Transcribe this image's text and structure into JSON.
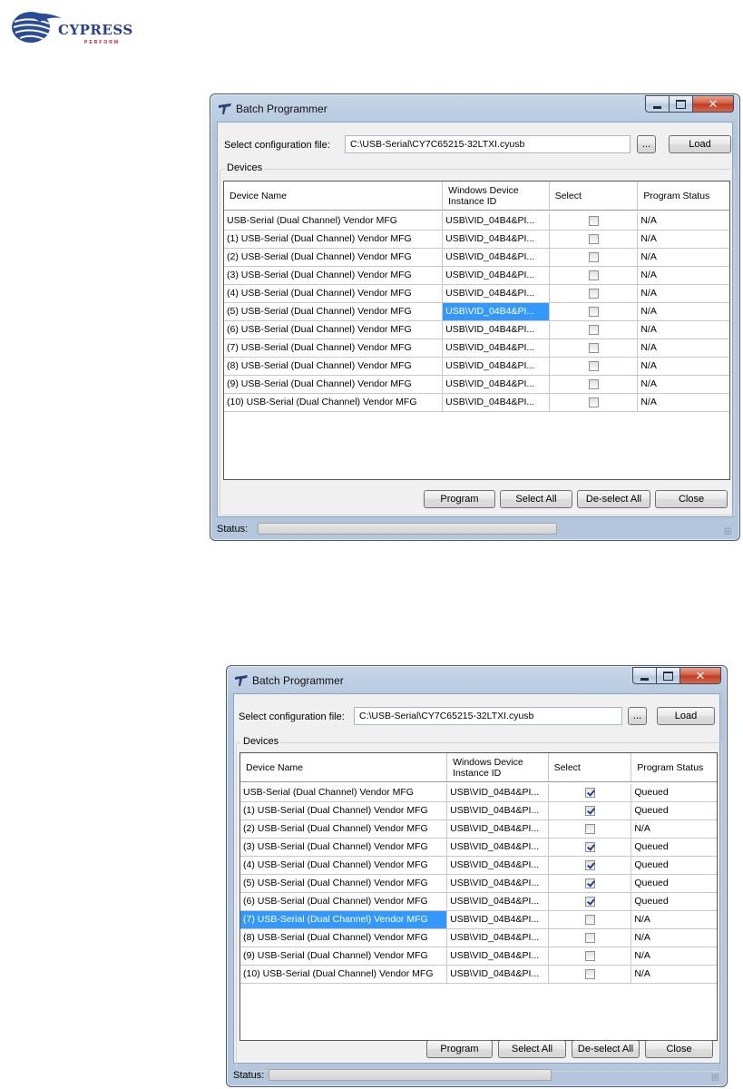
{
  "logo": {
    "brand": "CYPRESS",
    "tagline": "PERFORM"
  },
  "windows": [
    {
      "title": "Batch Programmer",
      "config_label": "Select configuration file:",
      "config_value": "C:\\USB-Serial\\CY7C65215-32LTXI.cyusb",
      "browse_label": "...",
      "load_label": "Load",
      "devices_label": "Devices",
      "columns": [
        "Device Name",
        "Windows Device Instance ID",
        "Select",
        "Program Status"
      ],
      "rows": [
        {
          "name": "USB-Serial (Dual Channel) Vendor MFG",
          "id": "USB\\VID_04B4&PI...",
          "checked": false,
          "status": "N/A",
          "selected": false
        },
        {
          "name": "(1) USB-Serial (Dual Channel) Vendor MFG",
          "id": "USB\\VID_04B4&PI...",
          "checked": false,
          "status": "N/A",
          "selected": false
        },
        {
          "name": "(2) USB-Serial (Dual Channel) Vendor MFG",
          "id": "USB\\VID_04B4&PI...",
          "checked": false,
          "status": "N/A",
          "selected": false
        },
        {
          "name": "(3) USB-Serial (Dual Channel) Vendor MFG",
          "id": "USB\\VID_04B4&PI...",
          "checked": false,
          "status": "N/A",
          "selected": false
        },
        {
          "name": "(4) USB-Serial (Dual Channel) Vendor MFG",
          "id": "USB\\VID_04B4&PI...",
          "checked": false,
          "status": "N/A",
          "selected": false
        },
        {
          "name": "(5) USB-Serial (Dual Channel) Vendor MFG",
          "id": "USB\\VID_04B4&PI...",
          "checked": false,
          "status": "N/A",
          "selected": true
        },
        {
          "name": "(6) USB-Serial (Dual Channel) Vendor MFG",
          "id": "USB\\VID_04B4&PI...",
          "checked": false,
          "status": "N/A",
          "selected": false
        },
        {
          "name": "(7) USB-Serial (Dual Channel) Vendor MFG",
          "id": "USB\\VID_04B4&PI...",
          "checked": false,
          "status": "N/A",
          "selected": false
        },
        {
          "name": "(8) USB-Serial (Dual Channel) Vendor MFG",
          "id": "USB\\VID_04B4&PI...",
          "checked": false,
          "status": "N/A",
          "selected": false
        },
        {
          "name": "(9) USB-Serial (Dual Channel) Vendor MFG",
          "id": "USB\\VID_04B4&PI...",
          "checked": false,
          "status": "N/A",
          "selected": false
        },
        {
          "name": "(10) USB-Serial (Dual Channel) Vendor MFG",
          "id": "USB\\VID_04B4&PI...",
          "checked": false,
          "status": "N/A",
          "selected": false
        }
      ],
      "buttons": [
        "Program",
        "Select All",
        "De-select All",
        "Close"
      ],
      "status_label": "Status:"
    },
    {
      "title": "Batch Programmer",
      "config_label": "Select configuration file:",
      "config_value": "C:\\USB-Serial\\CY7C65215-32LTXI.cyusb",
      "browse_label": "...",
      "load_label": "Load",
      "devices_label": "Devices",
      "columns": [
        "Device Name",
        "Windows Device Instance ID",
        "Select",
        "Program Status"
      ],
      "rows": [
        {
          "name": "USB-Serial (Dual Channel) Vendor MFG",
          "id": "USB\\VID_04B4&PI...",
          "checked": true,
          "status": "Queued",
          "selected": false
        },
        {
          "name": "(1) USB-Serial (Dual Channel) Vendor MFG",
          "id": "USB\\VID_04B4&PI...",
          "checked": true,
          "status": "Queued",
          "selected": false
        },
        {
          "name": "(2) USB-Serial (Dual Channel) Vendor MFG",
          "id": "USB\\VID_04B4&PI...",
          "checked": false,
          "status": "N/A",
          "selected": false
        },
        {
          "name": "(3) USB-Serial (Dual Channel) Vendor MFG",
          "id": "USB\\VID_04B4&PI...",
          "checked": true,
          "status": "Queued",
          "selected": false
        },
        {
          "name": "(4) USB-Serial (Dual Channel) Vendor MFG",
          "id": "USB\\VID_04B4&PI...",
          "checked": true,
          "status": "Queued",
          "selected": false
        },
        {
          "name": "(5) USB-Serial (Dual Channel) Vendor MFG",
          "id": "USB\\VID_04B4&PI...",
          "checked": true,
          "status": "Queued",
          "selected": false
        },
        {
          "name": "(6) USB-Serial (Dual Channel) Vendor MFG",
          "id": "USB\\VID_04B4&PI...",
          "checked": true,
          "status": "Queued",
          "selected": false
        },
        {
          "name": "(7) USB-Serial (Dual Channel) Vendor MFG",
          "id": "USB\\VID_04B4&PI...",
          "checked": false,
          "status": "N/A",
          "selected": true
        },
        {
          "name": "(8) USB-Serial (Dual Channel) Vendor MFG",
          "id": "USB\\VID_04B4&PI...",
          "checked": false,
          "status": "N/A",
          "selected": false
        },
        {
          "name": "(9) USB-Serial (Dual Channel) Vendor MFG",
          "id": "USB\\VID_04B4&PI...",
          "checked": false,
          "status": "N/A",
          "selected": false
        },
        {
          "name": "(10) USB-Serial (Dual Channel) Vendor MFG",
          "id": "USB\\VID_04B4&PI...",
          "checked": false,
          "status": "N/A",
          "selected": false
        }
      ],
      "buttons": [
        "Program",
        "Select All",
        "De-select All",
        "Close"
      ],
      "status_label": "Status:"
    }
  ]
}
